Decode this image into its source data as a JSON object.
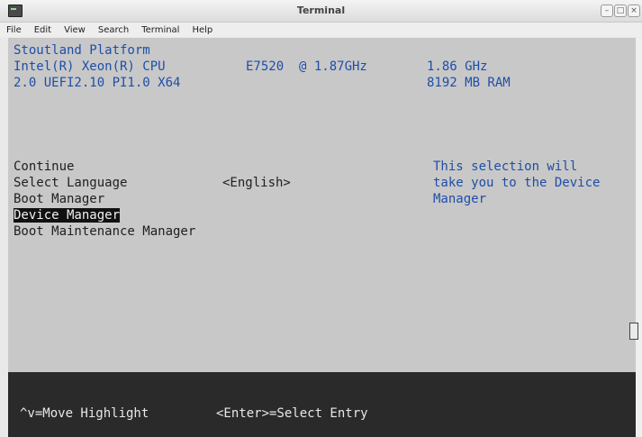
{
  "window": {
    "title": "Terminal",
    "buttons": [
      "minimize",
      "maximize",
      "close"
    ]
  },
  "menubar": {
    "items": [
      "File",
      "Edit",
      "View",
      "Search",
      "Terminal",
      "Help"
    ]
  },
  "header": {
    "platform": "Stoutland Platform",
    "cpu_name": "Intel(R) Xeon(R) CPU",
    "cpu_model": "E7520  @ 1.87GHz",
    "cpu_speed": "1.86 GHz",
    "firmware": "2.0 UEFI2.10 PI1.0 X64",
    "ram": "8192 MB RAM"
  },
  "menu": {
    "items": [
      {
        "label": "Continue",
        "selected": false
      },
      {
        "label": "Select Language",
        "value": "<English>",
        "selected": false
      },
      {
        "label": "Boot Manager",
        "selected": false
      },
      {
        "label": "Device Manager",
        "selected": true
      },
      {
        "label": "Boot Maintenance Manager",
        "selected": false
      }
    ],
    "help_lines": [
      "This selection will",
      "take you to the Device",
      "Manager"
    ]
  },
  "footer": {
    "move_hint": "^v=Move Highlight",
    "select_hint": "<Enter>=Select Entry"
  },
  "colors": {
    "screen_bg": "#c8c8c8",
    "bios_blue": "#1e4ea8",
    "footer_bg": "#2a2a2a",
    "highlight_bg": "#111111"
  }
}
